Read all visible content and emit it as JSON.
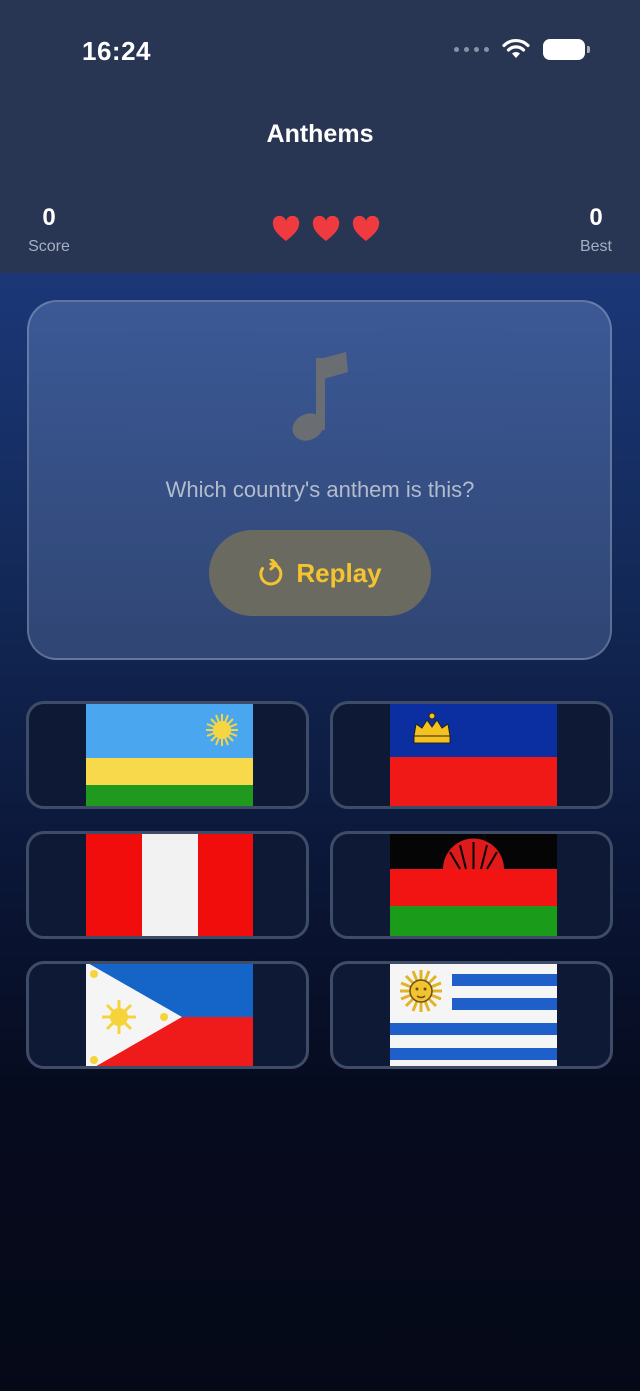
{
  "status_bar": {
    "time": "16:24"
  },
  "header": {
    "title": "Anthems"
  },
  "stats": {
    "score_value": "0",
    "score_label": "Score",
    "best_value": "0",
    "best_label": "Best",
    "lives": 3
  },
  "question_card": {
    "icon": "music-note-icon",
    "question": "Which country's anthem is this?",
    "replay_label": "Replay"
  },
  "options": [
    {
      "flag": "Rwanda"
    },
    {
      "flag": "Liechtenstein"
    },
    {
      "flag": "Peru"
    },
    {
      "flag": "Malawi"
    },
    {
      "flag": "Philippines"
    },
    {
      "flag": "Uruguay"
    }
  ],
  "colors": {
    "header_bg": "#283653",
    "heart": "#ef3b3f",
    "replay_text": "#f4c430",
    "replay_bg": "#6b6a61"
  }
}
